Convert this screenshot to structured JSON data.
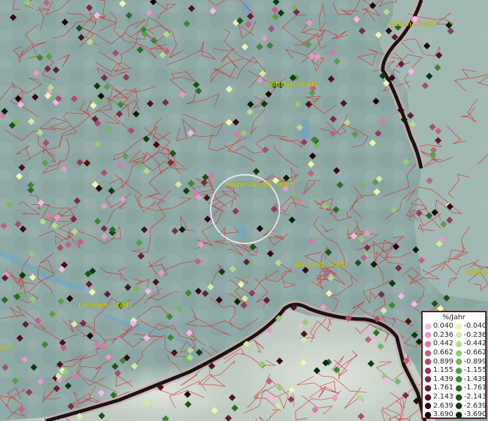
{
  "map": {
    "cities": [
      {
        "id": "guben",
        "name": "Guben, Stadt"
      },
      {
        "id": "cottbus",
        "name": "Cottbus, Stadt"
      },
      {
        "id": "hoyerswerda",
        "name": "Hoyerswerda, Stadt"
      },
      {
        "id": "bautzen",
        "name": "Bautzen, Stadt"
      },
      {
        "id": "dresden",
        "name": "Dresden, Stadt"
      },
      {
        "id": "goerlitz",
        "name": "Görlitz"
      },
      {
        "id": "left",
        "name": "adt"
      }
    ],
    "colors": {
      "background": "#8fa9a6",
      "border_lines": "#d22828",
      "country_border": "#1a1a1a",
      "highlight_circle": "#f0f0f0",
      "city_label": "#e8e000"
    }
  },
  "legend": {
    "title": "%/Jahr",
    "positive": [
      {
        "value": "0.040",
        "color": "#f5b8e8"
      },
      {
        "value": "0.236",
        "color": "#e59ac8"
      },
      {
        "value": "0.442",
        "color": "#d47aa8"
      },
      {
        "value": "0.662",
        "color": "#c06088"
      },
      {
        "value": "0.899",
        "color": "#a84e6e"
      },
      {
        "value": "1.155",
        "color": "#923c58"
      },
      {
        "value": "1.439",
        "color": "#7a2c44"
      },
      {
        "value": "1.761",
        "color": "#641e32"
      },
      {
        "value": "2.143",
        "color": "#4c1222"
      },
      {
        "value": "2.639",
        "color": "#360816"
      },
      {
        "value": "3.690",
        "color": "#20020a"
      }
    ],
    "negative": [
      {
        "value": "-0.040",
        "color": "#eef5b0"
      },
      {
        "value": "-0.236",
        "color": "#d6eaa4"
      },
      {
        "value": "-0.442",
        "color": "#b8da8e"
      },
      {
        "value": "-0.662",
        "color": "#98c878"
      },
      {
        "value": "-0.899",
        "color": "#78b462"
      },
      {
        "value": "-1.155",
        "color": "#5a9c4a"
      },
      {
        "value": "-1.439",
        "color": "#3e8434"
      },
      {
        "value": "-1.761",
        "color": "#2a6c24"
      },
      {
        "value": "-2.143",
        "color": "#1a5418"
      },
      {
        "value": "-2.639",
        "color": "#0c3c0e"
      },
      {
        "value": "-3.690",
        "color": "#042404"
      }
    ]
  }
}
